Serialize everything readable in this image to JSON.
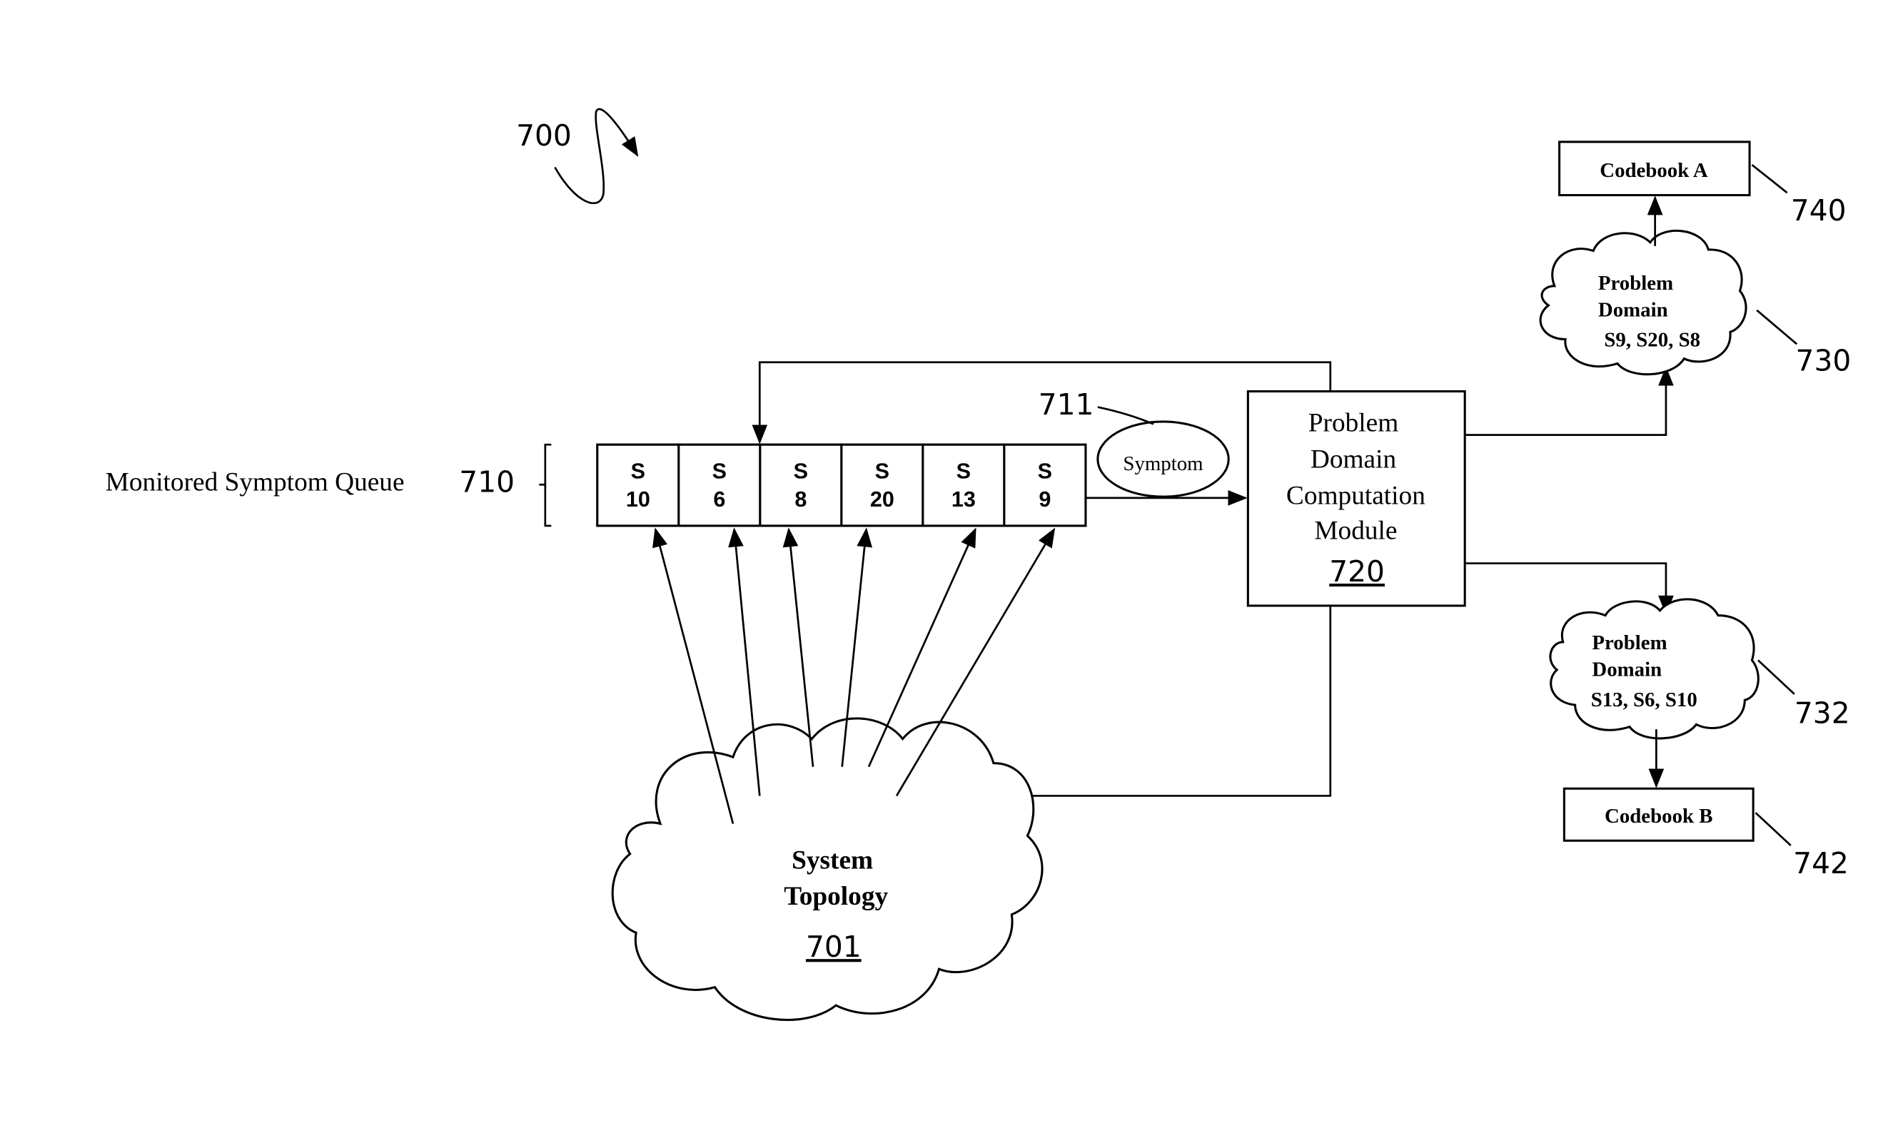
{
  "figure": {
    "ref": "700",
    "colors": {
      "ink": "#000000",
      "background": "#ffffff"
    }
  },
  "queue": {
    "label": "Monitored Symptom Queue",
    "ref": "710",
    "cells": [
      {
        "top": "S",
        "bottom": "10"
      },
      {
        "top": "S",
        "bottom": "6"
      },
      {
        "top": "S",
        "bottom": "8"
      },
      {
        "top": "S",
        "bottom": "20"
      },
      {
        "top": "S",
        "bottom": "13"
      },
      {
        "top": "S",
        "bottom": "9"
      }
    ]
  },
  "symptom": {
    "label": "Symptom",
    "ref": "711"
  },
  "module": {
    "lines": [
      "Problem",
      "Domain",
      "Computation",
      "Module"
    ],
    "ref": "720"
  },
  "topology": {
    "lines": [
      "System",
      "Topology"
    ],
    "ref": "701"
  },
  "domain_a": {
    "lines": [
      "Problem",
      "Domain",
      "S9, S20, S8"
    ],
    "ref": "730"
  },
  "domain_b": {
    "lines": [
      "Problem",
      "Domain",
      "S13, S6, S10"
    ],
    "ref": "732"
  },
  "codebook_a": {
    "label": "Codebook A",
    "ref": "740"
  },
  "codebook_b": {
    "label": "Codebook B",
    "ref": "742"
  }
}
